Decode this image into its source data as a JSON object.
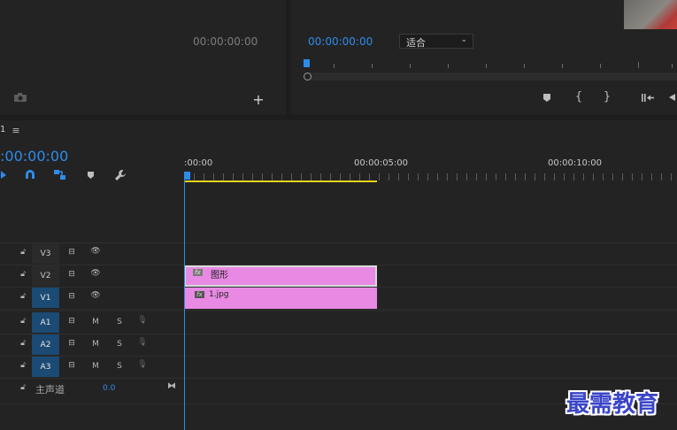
{
  "source_monitor": {
    "timecode": "00:00:00:00",
    "camera_icon": "camera-icon",
    "add_icon": "plus-icon"
  },
  "program_monitor": {
    "timecode": "00:00:00:00",
    "fit_select": "适合"
  },
  "transport": {
    "icons": [
      "marker-icon",
      "mark-in-icon",
      "mark-out-icon",
      "go-to-in-icon"
    ]
  },
  "timeline": {
    "sequence_tab": "1",
    "menu_icon": "hamburger-icon",
    "playhead_timecode": ":00:00:00",
    "tools": [
      "snap-icon",
      "magnet-icon",
      "linked-selection-icon",
      "add-marker-icon",
      "wrench-icon"
    ],
    "ruler_labels": [
      ":00:00",
      "00:00:05:00",
      "00:00:10:00"
    ],
    "tracks_video": [
      {
        "name": "V3",
        "target": false
      },
      {
        "name": "V2",
        "target": false
      },
      {
        "name": "V1",
        "target": true
      }
    ],
    "tracks_audio": [
      {
        "name": "A1",
        "m": "M",
        "s": "S"
      },
      {
        "name": "A2",
        "m": "M",
        "s": "S"
      },
      {
        "name": "A3",
        "m": "M",
        "s": "S"
      }
    ],
    "master": {
      "label": "主声道",
      "value": "0.0"
    },
    "clips": [
      {
        "track": "V2",
        "label": "图形",
        "fx": "fx"
      },
      {
        "track": "V1",
        "label": "1.jpg",
        "fx": "fx"
      }
    ]
  },
  "watermark": "最需教育",
  "colors": {
    "accent": "#2d8ceb",
    "clip": "#e88ae3",
    "work_area": "#e5d21a",
    "target": "#1b4a74"
  }
}
